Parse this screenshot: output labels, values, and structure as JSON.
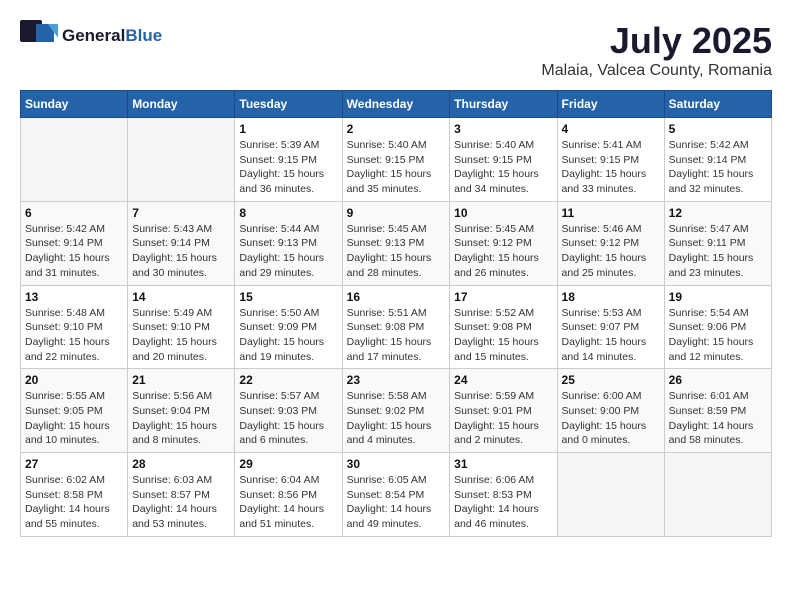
{
  "logo": {
    "general": "General",
    "blue": "Blue"
  },
  "title": "July 2025",
  "location": "Malaia, Valcea County, Romania",
  "days_header": [
    "Sunday",
    "Monday",
    "Tuesday",
    "Wednesday",
    "Thursday",
    "Friday",
    "Saturday"
  ],
  "weeks": [
    [
      {
        "day": "",
        "info": ""
      },
      {
        "day": "",
        "info": ""
      },
      {
        "day": "1",
        "info": "Sunrise: 5:39 AM\nSunset: 9:15 PM\nDaylight: 15 hours\nand 36 minutes."
      },
      {
        "day": "2",
        "info": "Sunrise: 5:40 AM\nSunset: 9:15 PM\nDaylight: 15 hours\nand 35 minutes."
      },
      {
        "day": "3",
        "info": "Sunrise: 5:40 AM\nSunset: 9:15 PM\nDaylight: 15 hours\nand 34 minutes."
      },
      {
        "day": "4",
        "info": "Sunrise: 5:41 AM\nSunset: 9:15 PM\nDaylight: 15 hours\nand 33 minutes."
      },
      {
        "day": "5",
        "info": "Sunrise: 5:42 AM\nSunset: 9:14 PM\nDaylight: 15 hours\nand 32 minutes."
      }
    ],
    [
      {
        "day": "6",
        "info": "Sunrise: 5:42 AM\nSunset: 9:14 PM\nDaylight: 15 hours\nand 31 minutes."
      },
      {
        "day": "7",
        "info": "Sunrise: 5:43 AM\nSunset: 9:14 PM\nDaylight: 15 hours\nand 30 minutes."
      },
      {
        "day": "8",
        "info": "Sunrise: 5:44 AM\nSunset: 9:13 PM\nDaylight: 15 hours\nand 29 minutes."
      },
      {
        "day": "9",
        "info": "Sunrise: 5:45 AM\nSunset: 9:13 PM\nDaylight: 15 hours\nand 28 minutes."
      },
      {
        "day": "10",
        "info": "Sunrise: 5:45 AM\nSunset: 9:12 PM\nDaylight: 15 hours\nand 26 minutes."
      },
      {
        "day": "11",
        "info": "Sunrise: 5:46 AM\nSunset: 9:12 PM\nDaylight: 15 hours\nand 25 minutes."
      },
      {
        "day": "12",
        "info": "Sunrise: 5:47 AM\nSunset: 9:11 PM\nDaylight: 15 hours\nand 23 minutes."
      }
    ],
    [
      {
        "day": "13",
        "info": "Sunrise: 5:48 AM\nSunset: 9:10 PM\nDaylight: 15 hours\nand 22 minutes."
      },
      {
        "day": "14",
        "info": "Sunrise: 5:49 AM\nSunset: 9:10 PM\nDaylight: 15 hours\nand 20 minutes."
      },
      {
        "day": "15",
        "info": "Sunrise: 5:50 AM\nSunset: 9:09 PM\nDaylight: 15 hours\nand 19 minutes."
      },
      {
        "day": "16",
        "info": "Sunrise: 5:51 AM\nSunset: 9:08 PM\nDaylight: 15 hours\nand 17 minutes."
      },
      {
        "day": "17",
        "info": "Sunrise: 5:52 AM\nSunset: 9:08 PM\nDaylight: 15 hours\nand 15 minutes."
      },
      {
        "day": "18",
        "info": "Sunrise: 5:53 AM\nSunset: 9:07 PM\nDaylight: 15 hours\nand 14 minutes."
      },
      {
        "day": "19",
        "info": "Sunrise: 5:54 AM\nSunset: 9:06 PM\nDaylight: 15 hours\nand 12 minutes."
      }
    ],
    [
      {
        "day": "20",
        "info": "Sunrise: 5:55 AM\nSunset: 9:05 PM\nDaylight: 15 hours\nand 10 minutes."
      },
      {
        "day": "21",
        "info": "Sunrise: 5:56 AM\nSunset: 9:04 PM\nDaylight: 15 hours\nand 8 minutes."
      },
      {
        "day": "22",
        "info": "Sunrise: 5:57 AM\nSunset: 9:03 PM\nDaylight: 15 hours\nand 6 minutes."
      },
      {
        "day": "23",
        "info": "Sunrise: 5:58 AM\nSunset: 9:02 PM\nDaylight: 15 hours\nand 4 minutes."
      },
      {
        "day": "24",
        "info": "Sunrise: 5:59 AM\nSunset: 9:01 PM\nDaylight: 15 hours\nand 2 minutes."
      },
      {
        "day": "25",
        "info": "Sunrise: 6:00 AM\nSunset: 9:00 PM\nDaylight: 15 hours\nand 0 minutes."
      },
      {
        "day": "26",
        "info": "Sunrise: 6:01 AM\nSunset: 8:59 PM\nDaylight: 14 hours\nand 58 minutes."
      }
    ],
    [
      {
        "day": "27",
        "info": "Sunrise: 6:02 AM\nSunset: 8:58 PM\nDaylight: 14 hours\nand 55 minutes."
      },
      {
        "day": "28",
        "info": "Sunrise: 6:03 AM\nSunset: 8:57 PM\nDaylight: 14 hours\nand 53 minutes."
      },
      {
        "day": "29",
        "info": "Sunrise: 6:04 AM\nSunset: 8:56 PM\nDaylight: 14 hours\nand 51 minutes."
      },
      {
        "day": "30",
        "info": "Sunrise: 6:05 AM\nSunset: 8:54 PM\nDaylight: 14 hours\nand 49 minutes."
      },
      {
        "day": "31",
        "info": "Sunrise: 6:06 AM\nSunset: 8:53 PM\nDaylight: 14 hours\nand 46 minutes."
      },
      {
        "day": "",
        "info": ""
      },
      {
        "day": "",
        "info": ""
      }
    ]
  ]
}
